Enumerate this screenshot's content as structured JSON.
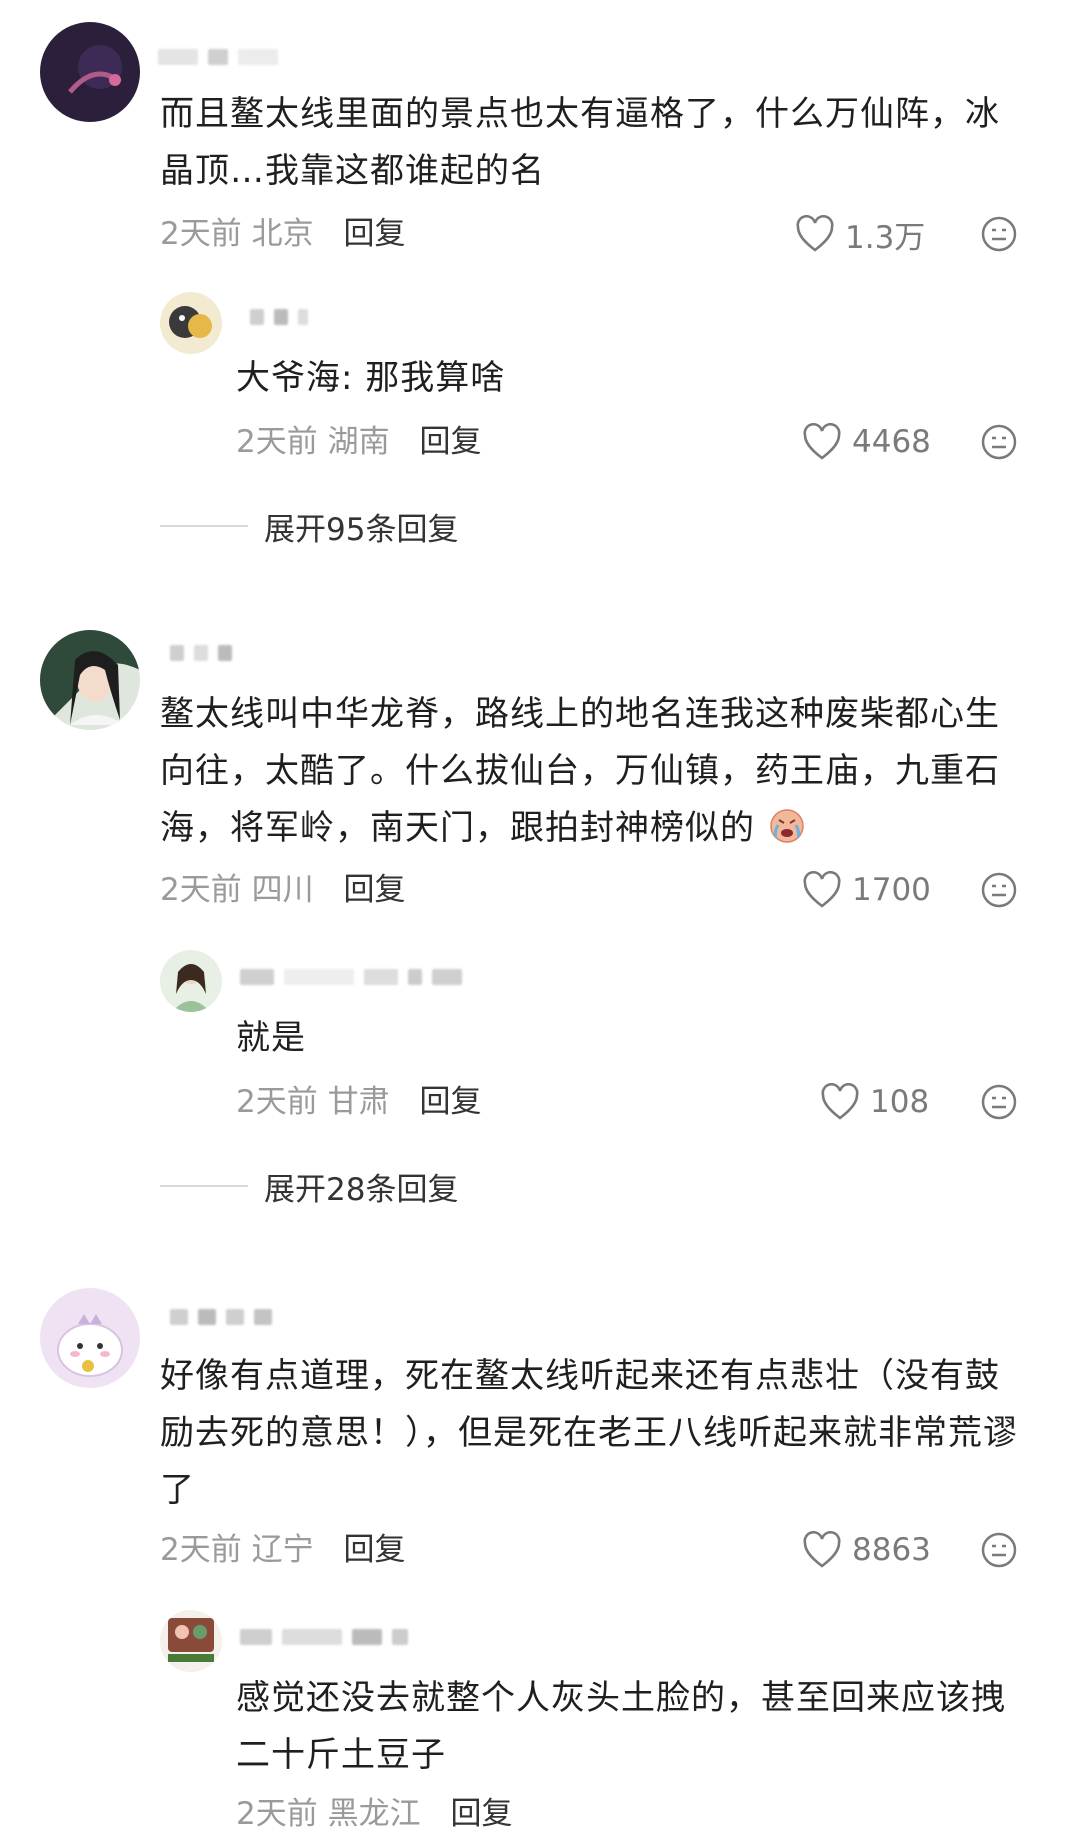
{
  "comments": [
    {
      "text": "而且鳌太线里面的景点也太有逼格了，什么万仙阵，冰晶顶…我靠这都谁起的名",
      "time": "2天前",
      "location": "北京",
      "reply_label": "回复",
      "likes": "1.3万",
      "reply": {
        "text": "大爷海: 那我算啥",
        "time": "2天前",
        "location": "湖南",
        "reply_label": "回复",
        "likes": "4468"
      },
      "expand_label": "展开95条回复"
    },
    {
      "text": "鳌太线叫中华龙脊，路线上的地名连我这种废柴都心生向往，太酷了。什么拔仙台，万仙镇，药王庙，九重石海，将军岭，南天门，跟拍封神榜似的",
      "time": "2天前",
      "location": "四川",
      "reply_label": "回复",
      "likes": "1700",
      "reply": {
        "text": "就是",
        "time": "2天前",
        "location": "甘肃",
        "reply_label": "回复",
        "likes": "108"
      },
      "expand_label": "展开28条回复"
    },
    {
      "text": "好像有点道理，死在鳌太线听起来还有点悲壮（没有鼓励去死的意思！），但是死在老王八线听起来就非常荒谬了",
      "time": "2天前",
      "location": "辽宁",
      "reply_label": "回复",
      "likes": "8863",
      "reply": {
        "text": "感觉还没去就整个人灰头土脸的，甚至回来应该拽二十斤土豆子",
        "time": "2天前",
        "location": "黑龙江",
        "reply_label": "回复"
      }
    }
  ],
  "icons": {
    "like": "heart-outline-icon",
    "reaction": "neutral-face-icon",
    "emoji": "crying-face-emoji"
  },
  "colors": {
    "meta": "#9a9a9a",
    "text": "#1f1f1f"
  }
}
